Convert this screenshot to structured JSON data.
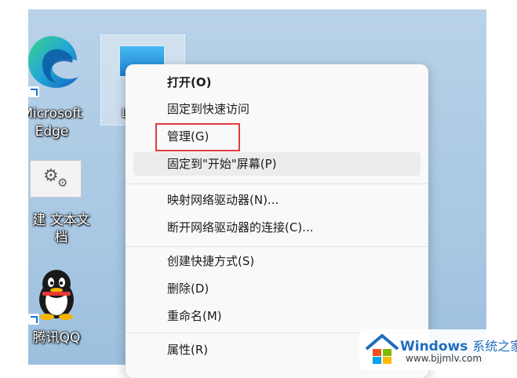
{
  "desktop": {
    "icons": [
      {
        "label_lines": [
          "Microsoft",
          "Edge"
        ],
        "icon": "edge-icon"
      },
      {
        "label_lines": [
          "建 文本文",
          "档"
        ],
        "icon": "text-file-icon"
      },
      {
        "label_lines": [
          "腾讯QQ"
        ],
        "icon": "qq-icon"
      }
    ],
    "selected_icon": {
      "icon": "this-pc-icon",
      "label_partial": "山"
    }
  },
  "context_menu": {
    "items": [
      {
        "label": "打开(O)",
        "bold": true
      },
      {
        "label": "固定到快速访问"
      },
      {
        "label": "管理(G)",
        "highlighted": true
      },
      {
        "label": "固定到\"开始\"屏幕(P)",
        "hover": true
      },
      {
        "label": "映射网络驱动器(N)..."
      },
      {
        "label": "断开网络驱动器的连接(C)..."
      },
      {
        "label": "创建快捷方式(S)"
      },
      {
        "label": "删除(D)"
      },
      {
        "label": "重命名(M)"
      },
      {
        "label": "属性(R)"
      }
    ]
  },
  "watermark": {
    "brand": "Windows",
    "brand_cn": "系统之家",
    "url": "www.bjjmlv.com"
  },
  "colors": {
    "highlight_box": "#e03b3b",
    "watermark_blue": "#1f6dbd"
  }
}
